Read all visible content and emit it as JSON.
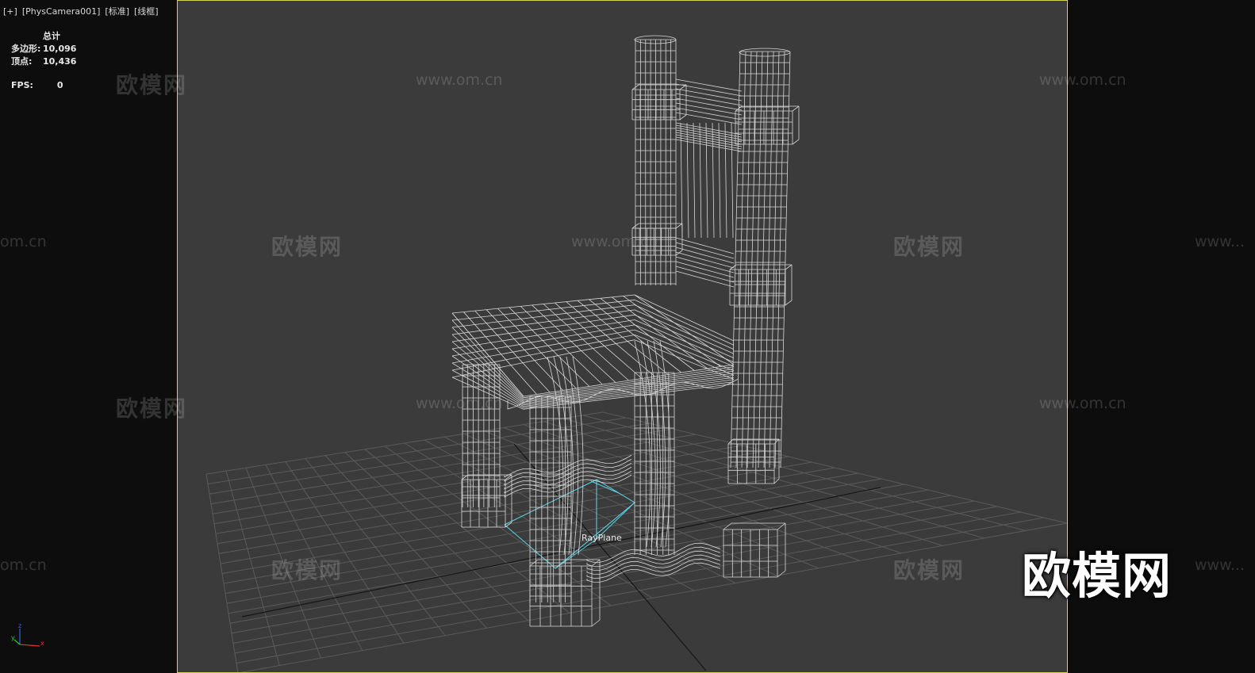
{
  "viewport": {
    "plus": "[+]",
    "camera": "[PhysCamera001]",
    "shading": "[标准]",
    "mode": "[线框]"
  },
  "stats": {
    "header": "总计",
    "polygons_label": "多边形:",
    "polygons_value": "10,096",
    "vertices_label": "顶点:",
    "vertices_value": "10,436",
    "fps_label": "FPS:",
    "fps_value": "0"
  },
  "scene": {
    "object_label": "RayPlane",
    "wireframe_color": "#e0e0e0",
    "grid_color": "#5a5a5a",
    "light_color": "#5fd3e6",
    "frame_color": "#d6d34a"
  },
  "watermark": {
    "cn": "欧模网",
    "url": "www.om.cn",
    "partial_url": "www...",
    "partial_cn": "om.cn"
  },
  "brand_logo": "欧模网",
  "axis_gizmo": {
    "x": "x",
    "y": "y",
    "z": "z"
  }
}
